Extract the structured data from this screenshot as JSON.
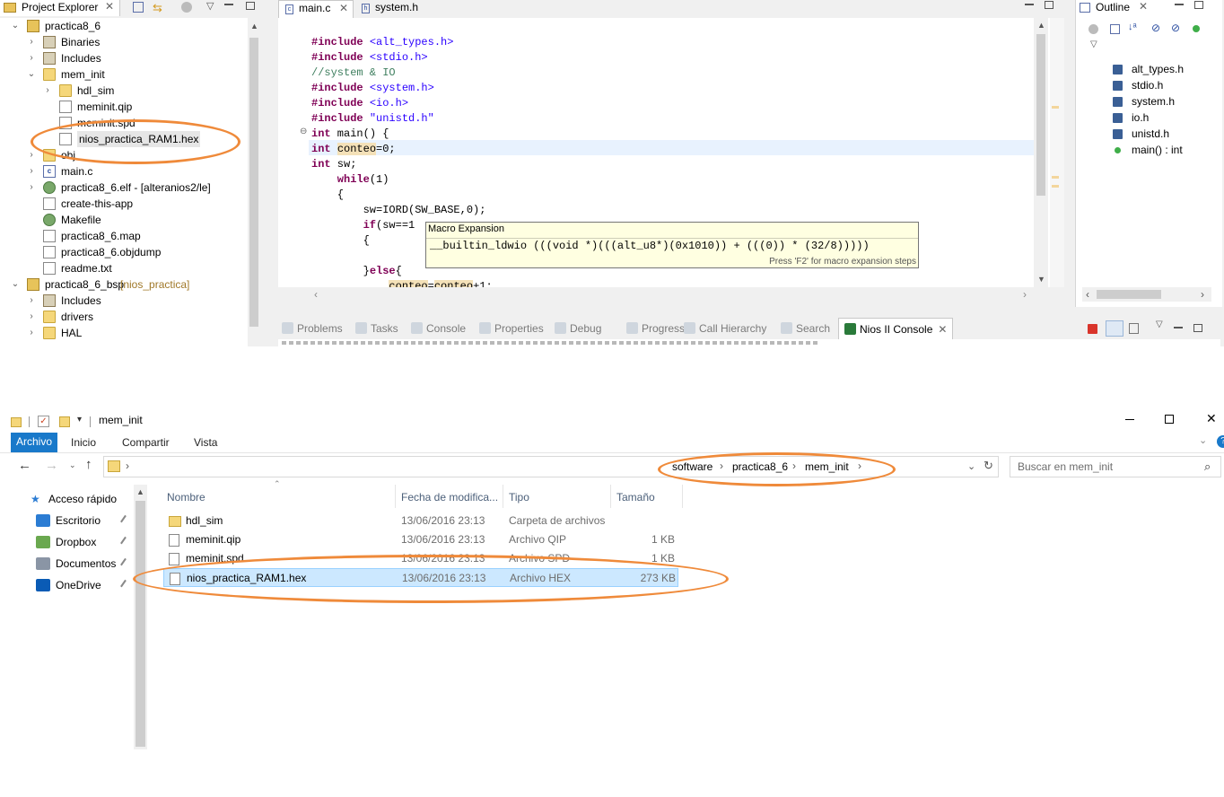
{
  "eclipse": {
    "project_explorer": {
      "title": "Project Explorer",
      "items": [
        {
          "label": "practica8_6",
          "level": 0,
          "twisty": "open",
          "icon": "project-icon"
        },
        {
          "label": "Binaries",
          "level": 1,
          "twisty": "closed",
          "icon": "binaries-icon"
        },
        {
          "label": "Includes",
          "level": 1,
          "twisty": "closed",
          "icon": "includes-icon"
        },
        {
          "label": "mem_init",
          "level": 1,
          "twisty": "open",
          "icon": "folder-icon"
        },
        {
          "label": "hdl_sim",
          "level": 2,
          "twisty": "closed",
          "icon": "folder-icon"
        },
        {
          "label": "meminit.qip",
          "level": 2,
          "twisty": "",
          "icon": "file-icon"
        },
        {
          "label": "meminit.spd",
          "level": 2,
          "twisty": "",
          "icon": "file-icon"
        },
        {
          "label": "nios_practica_RAM1.hex",
          "level": 2,
          "twisty": "",
          "icon": "file-icon",
          "selected": true
        },
        {
          "label": "obj",
          "level": 1,
          "twisty": "closed",
          "icon": "folder-icon"
        },
        {
          "label": "main.c",
          "level": 1,
          "twisty": "closed",
          "icon": "c-file-icon"
        },
        {
          "label": "practica8_6.elf - [alteranios2/le]",
          "level": 1,
          "twisty": "closed",
          "icon": "binary-icon"
        },
        {
          "label": "create-this-app",
          "level": 1,
          "twisty": "",
          "icon": "file-icon"
        },
        {
          "label": "Makefile",
          "level": 1,
          "twisty": "",
          "icon": "makefile-icon"
        },
        {
          "label": "practica8_6.map",
          "level": 1,
          "twisty": "",
          "icon": "file-icon"
        },
        {
          "label": "practica8_6.objdump",
          "level": 1,
          "twisty": "",
          "icon": "file-icon"
        },
        {
          "label": "readme.txt",
          "level": 1,
          "twisty": "",
          "icon": "file-icon"
        },
        {
          "label": "practica8_6_bsp",
          "level": 0,
          "twisty": "open",
          "icon": "project-icon",
          "suffix": "[nios_practica]"
        },
        {
          "label": "Includes",
          "level": 1,
          "twisty": "closed",
          "icon": "includes-icon"
        },
        {
          "label": "drivers",
          "level": 1,
          "twisty": "closed",
          "icon": "folder-icon"
        },
        {
          "label": "HAL",
          "level": 1,
          "twisty": "closed",
          "icon": "folder-icon"
        }
      ]
    },
    "editor": {
      "tabs": [
        {
          "label": "main.c",
          "active": true,
          "closable": true
        },
        {
          "label": "system.h",
          "active": false,
          "closable": false
        }
      ],
      "code_lines": [
        {
          "parts": [
            {
              "t": "#include ",
              "c": "kw"
            },
            {
              "t": "<alt_types.h>",
              "c": "str"
            }
          ]
        },
        {
          "parts": [
            {
              "t": "#include ",
              "c": "kw"
            },
            {
              "t": "<stdio.h>",
              "c": "str"
            }
          ]
        },
        {
          "parts": [
            {
              "t": "//system & IO",
              "c": "cmt"
            }
          ]
        },
        {
          "parts": [
            {
              "t": "#include ",
              "c": "kw"
            },
            {
              "t": "<system.h>",
              "c": "str"
            }
          ]
        },
        {
          "parts": [
            {
              "t": "#include ",
              "c": "kw"
            },
            {
              "t": "<io.h>",
              "c": "str"
            }
          ]
        },
        {
          "parts": [
            {
              "t": "#include ",
              "c": "kw"
            },
            {
              "t": "\"unistd.h\"",
              "c": "str"
            }
          ]
        },
        {
          "parts": [
            {
              "t": "int",
              "c": "kw"
            },
            {
              "t": " main() {",
              "c": ""
            }
          ]
        },
        {
          "parts": [
            {
              "t": "int",
              "c": "kw"
            },
            {
              "t": " ",
              "c": ""
            },
            {
              "t": "conteo",
              "c": "occ"
            },
            {
              "t": "=0;",
              "c": ""
            }
          ],
          "highlight": true
        },
        {
          "parts": [
            {
              "t": "int",
              "c": "kw"
            },
            {
              "t": " sw;",
              "c": ""
            }
          ]
        },
        {
          "parts": [
            {
              "t": "    while",
              "c": "kw"
            },
            {
              "t": "(1)",
              "c": ""
            }
          ]
        },
        {
          "parts": [
            {
              "t": "    {",
              "c": ""
            }
          ]
        },
        {
          "parts": [
            {
              "t": "        sw=IORD(SW_BASE,0);",
              "c": ""
            }
          ]
        },
        {
          "parts": [
            {
              "t": "        if",
              "c": "kw"
            },
            {
              "t": "(sw==1",
              "c": ""
            }
          ]
        },
        {
          "parts": [
            {
              "t": "        {",
              "c": ""
            }
          ]
        },
        {
          "parts": [
            {
              "t": "",
              "c": ""
            }
          ]
        },
        {
          "parts": [
            {
              "t": "        }",
              "c": ""
            },
            {
              "t": "else",
              "c": "kw"
            },
            {
              "t": "{",
              "c": ""
            }
          ]
        },
        {
          "parts": [
            {
              "t": "            ",
              "c": ""
            },
            {
              "t": "conteo",
              "c": "occ"
            },
            {
              "t": "=",
              "c": ""
            },
            {
              "t": "conteo",
              "c": "occ"
            },
            {
              "t": "+1;",
              "c": ""
            }
          ]
        }
      ],
      "tooltip": {
        "title": "Macro Expansion",
        "code": "__builtin_ldwio (((void *)(((alt_u8*)(0x1010)) + (((0)) * (32/8)))))",
        "hint": "Press 'F2' for macro expansion steps"
      }
    },
    "outline": {
      "title": "Outline",
      "items": [
        {
          "label": "alt_types.h",
          "icon": "include-icon"
        },
        {
          "label": "stdio.h",
          "icon": "include-icon"
        },
        {
          "label": "system.h",
          "icon": "include-icon"
        },
        {
          "label": "io.h",
          "icon": "include-icon"
        },
        {
          "label": "unistd.h",
          "icon": "include-icon"
        },
        {
          "label": "main() : int",
          "icon": "function-icon"
        }
      ]
    },
    "bottom_tabs": [
      {
        "label": "Problems",
        "active": false
      },
      {
        "label": "Tasks",
        "active": false
      },
      {
        "label": "Console",
        "active": false
      },
      {
        "label": "Properties",
        "active": false
      },
      {
        "label": "Debug",
        "active": false
      },
      {
        "label": "Progress",
        "active": false
      },
      {
        "label": "Call Hierarchy",
        "active": false
      },
      {
        "label": "Search",
        "active": false
      },
      {
        "label": "Nios II Console",
        "active": true
      }
    ]
  },
  "explorer": {
    "window_title": "mem_init",
    "ribbon_tabs": [
      "Archivo",
      "Inicio",
      "Compartir",
      "Vista"
    ],
    "address_segments": [
      "software",
      "practica8_6",
      "mem_init"
    ],
    "search_placeholder": "Buscar en mem_init",
    "nav_items": [
      {
        "label": "Acceso rápido",
        "icon": "star-icon",
        "pinned": false
      },
      {
        "label": "Escritorio",
        "icon": "desktop-icon",
        "pinned": true
      },
      {
        "label": "Dropbox",
        "icon": "dropbox-icon",
        "pinned": true
      },
      {
        "label": "Documentos",
        "icon": "documents-icon",
        "pinned": true
      },
      {
        "label": "OneDrive",
        "icon": "onedrive-icon",
        "pinned": true
      }
    ],
    "columns": [
      "Nombre",
      "Fecha de modifica...",
      "Tipo",
      "Tamaño"
    ],
    "files": [
      {
        "name": "hdl_sim",
        "date": "13/06/2016 23:13",
        "type": "Carpeta de archivos",
        "size": "",
        "icon": "folder-icon",
        "selected": false
      },
      {
        "name": "meminit.qip",
        "date": "13/06/2016 23:13",
        "type": "Archivo QIP",
        "size": "1 KB",
        "icon": "file-icon",
        "selected": false
      },
      {
        "name": "meminit.spd",
        "date": "13/06/2016 23:13",
        "type": "Archivo SPD",
        "size": "1 KB",
        "icon": "file-icon",
        "selected": false
      },
      {
        "name": "nios_practica_RAM1.hex",
        "date": "13/06/2016 23:13",
        "type": "Archivo HEX",
        "size": "273 KB",
        "icon": "file-icon",
        "selected": true
      }
    ]
  }
}
